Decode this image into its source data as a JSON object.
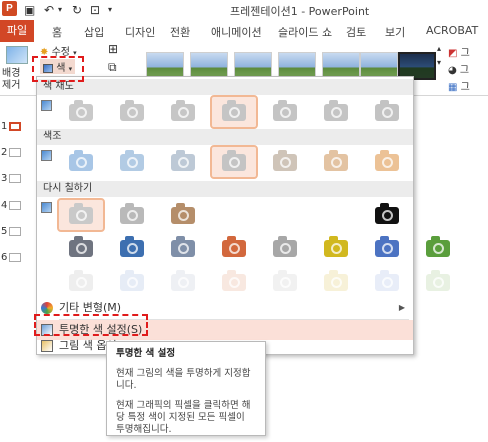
{
  "window": {
    "title": "프레젠테이션1 - PowerPoint",
    "app_badge": "P"
  },
  "ribbon_tabs": [
    {
      "label": "파일"
    },
    {
      "label": "홈"
    },
    {
      "label": "삽입"
    },
    {
      "label": "디자인"
    },
    {
      "label": "전환"
    },
    {
      "label": "애니메이션"
    },
    {
      "label": "슬라이드 쇼"
    },
    {
      "label": "검토"
    },
    {
      "label": "보기"
    },
    {
      "label": "ACROBAT"
    }
  ],
  "ribbon": {
    "remove_bg_label_1": "배경",
    "remove_bg_label_2": "제거",
    "corrections_label": "수정",
    "color_label": "색",
    "right_items": [
      "그",
      "그",
      "그"
    ]
  },
  "slides": [
    "1",
    "2",
    "3",
    "4",
    "5",
    "6"
  ],
  "color_menu": {
    "saturation": {
      "header": "색 채도",
      "swatch_colors": [
        "#c9c9c9",
        "#c7c7c7",
        "#c6c6c6",
        "#c5c5c5",
        "#c4c4c4",
        "#c4c4c4",
        "#c3c3c3"
      ],
      "selected_index": 3
    },
    "tone": {
      "header": "색조",
      "swatch_colors": [
        "#a8c6e6",
        "#b2cbe4",
        "#bdc9d6",
        "#c4c4c4",
        "#cfc4b8",
        "#e3c3a2",
        "#ecc296"
      ],
      "selected_index": 3
    },
    "recolor": {
      "header": "다시 칠하기",
      "row1_colors": [
        "#c9c9c9",
        "#b9b9b9",
        "#b58e6a"
      ],
      "row1_selected_index": 0,
      "black_white_color": "#111111",
      "row2_colors": [
        "#6f7480",
        "#3d6fb0",
        "#7f8fa8",
        "#d2683d",
        "#a7a7a7",
        "#d1b81f",
        "#4c73c2",
        "#5a9e3c"
      ],
      "row3_colors": [
        "#eeeeee",
        "#e6ecf6",
        "#eef0f4",
        "#f8e8e0",
        "#f1f1f1",
        "#f7f1d8",
        "#e8edf8",
        "#e8f1e2"
      ]
    },
    "more_variations": "기타 변형(M)",
    "set_transparent": "투명한 색 설정(S)",
    "picture_color_options": "그림 색 옵션(C)..."
  },
  "tooltip": {
    "title": "투명한 색 설정",
    "paragraph_1": "현재 그림의 색을 투명하게 지정합니다.",
    "paragraph_2": "현재 그래픽의 픽셀을 클릭하면 해당 특정 색이 지정된 모든 픽셀이 투명해집니다."
  }
}
